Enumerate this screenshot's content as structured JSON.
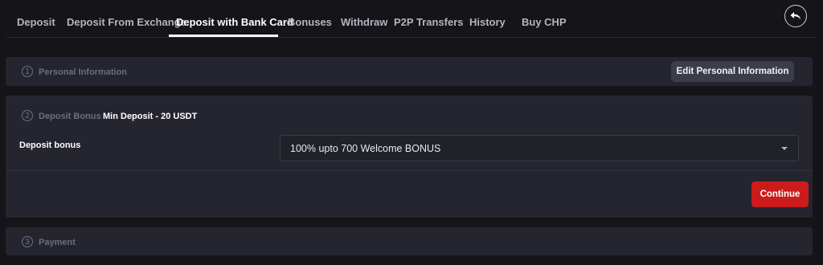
{
  "tabs": [
    {
      "label": "Deposit"
    },
    {
      "label": "Deposit From Exchange"
    },
    {
      "label": "Deposit with Bank Card"
    },
    {
      "label": "Bonuses"
    },
    {
      "label": "Withdraw"
    },
    {
      "label": "P2P Transfers"
    },
    {
      "label": "History"
    },
    {
      "label": "Buy CHP"
    }
  ],
  "active_tab": "Deposit with Bank Card",
  "steps": {
    "personal": {
      "number": "1",
      "title": "Personal Information",
      "edit_button": "Edit Personal Information"
    },
    "bonus": {
      "number": "2",
      "title": "Deposit Bonus",
      "min_deposit": "Min Deposit - 20 USDT",
      "field_label": "Deposit bonus",
      "selected_value": "100% upto 700 Welcome BONUS",
      "continue_button": "Continue"
    },
    "payment": {
      "number": "3",
      "title": "Payment"
    }
  },
  "icons": {
    "back": "back-arrow-icon",
    "dropdown": "chevron-down-icon"
  },
  "colors": {
    "background": "#141419",
    "panel": "#24252f",
    "accent_red": "#cc1b1b",
    "active_tab": "#ffffff"
  }
}
